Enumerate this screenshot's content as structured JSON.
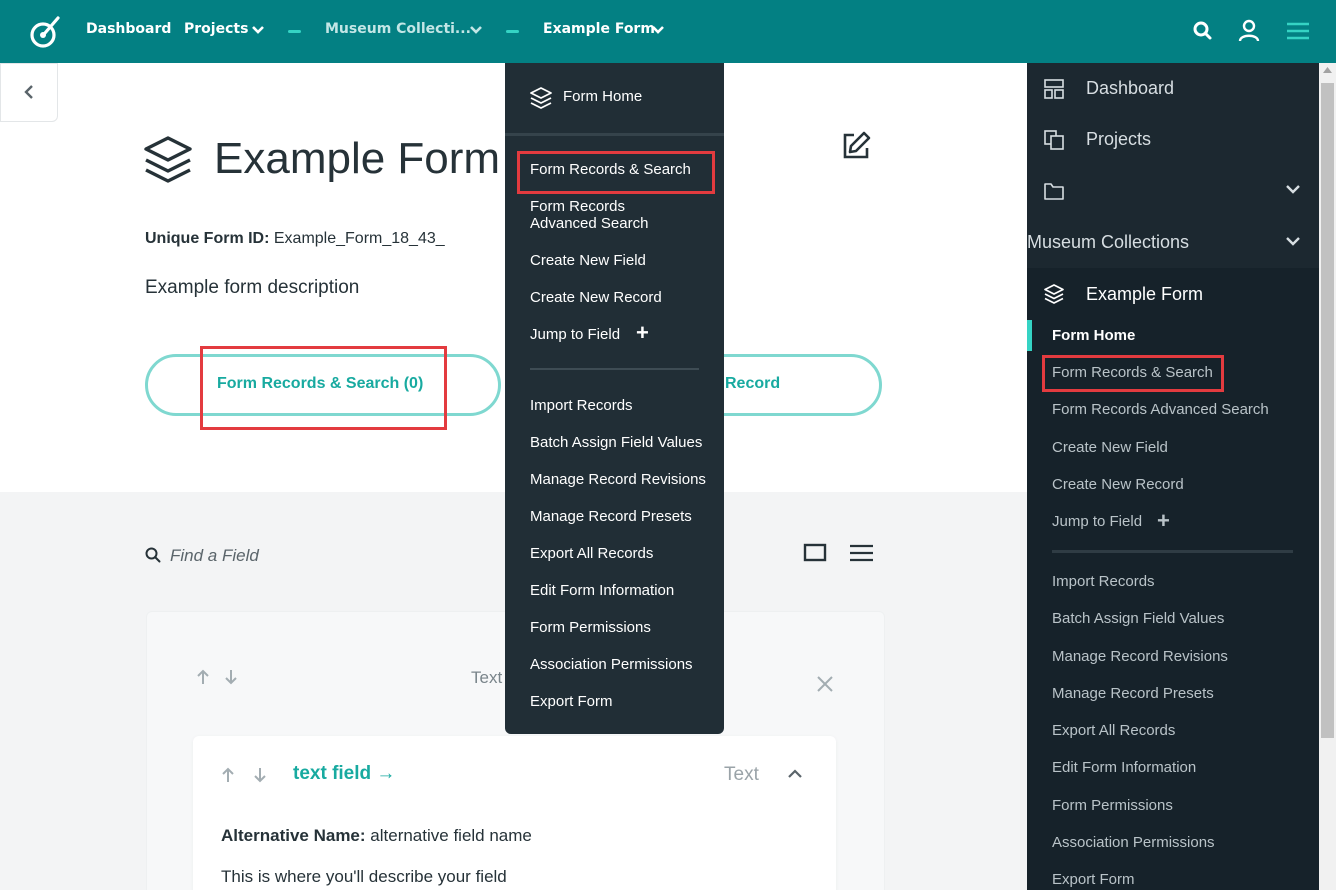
{
  "topnav": {
    "dashboard": "Dashboard",
    "projects": "Projects",
    "project_name": "Museum Collecti...",
    "form_name": "Example Form"
  },
  "form": {
    "title": "Example Form",
    "uid_label": "Unique Form ID:",
    "uid_value": " Example_Form_18_43_",
    "description": "Example form description",
    "records_button": "Form Records & Search (0)",
    "new_record_button": "Record"
  },
  "fields": {
    "search_placeholder": "Find a Field",
    "page_type": "Text",
    "field": {
      "name": "text field →",
      "type": "Text",
      "alt_label": "Alternative Name:",
      "alt_value": " alternative field name",
      "description": "This is where you'll describe your field"
    }
  },
  "dropdown": {
    "home": "Form Home",
    "items": [
      "Form Records & Search",
      "Form Records Advanced Search",
      "Create New Field",
      "Create New Record",
      "Jump to Field",
      "Import Records",
      "Batch Assign Field Values",
      "Manage Record Revisions",
      "Manage Record Presets",
      "Export All Records",
      "Edit Form Information",
      "Form Permissions",
      "Association Permissions",
      "Export Form"
    ],
    "advanced_line1": "Form Records",
    "advanced_line2": "Advanced Search",
    "jump_plus": "+"
  },
  "sidebar": {
    "dashboard": "Dashboard",
    "projects": "Projects",
    "project": "Museum Collections",
    "form": "Example Form",
    "items": [
      "Form Home",
      "Form Records & Search",
      "Form Records Advanced Search",
      "Create New Field",
      "Create New Record",
      "Jump to Field",
      "Import Records",
      "Batch Assign Field Values",
      "Manage Record Revisions",
      "Manage Record Presets",
      "Export All Records",
      "Edit Form Information",
      "Form Permissions",
      "Association Permissions",
      "Export Form"
    ],
    "jump_plus": "+"
  },
  "colors": {
    "topbar": "#038083",
    "accent": "#18aaa0",
    "highlight": "#e33b3f",
    "menu_bg": "#212e36",
    "sidebar_bg": "#1c2830"
  }
}
